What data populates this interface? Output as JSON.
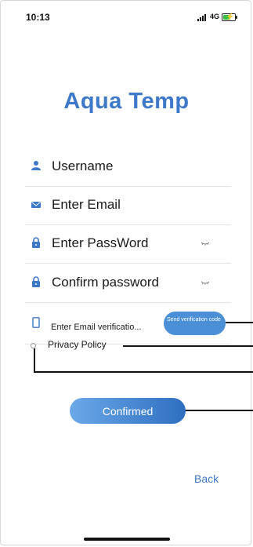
{
  "status_bar": {
    "time": "10:13",
    "network": "4G"
  },
  "app": {
    "title": "Aqua Temp"
  },
  "form": {
    "username_placeholder": "Username",
    "email_placeholder": "Enter Email",
    "password_placeholder": "Enter PassWord",
    "confirm_password_placeholder": "Confirm password",
    "verification_placeholder": "Enter Email verificatio...",
    "send_code_label": "Send verification code"
  },
  "privacy": {
    "label": "Privacy Policy"
  },
  "actions": {
    "confirm_label": "Confirmed",
    "back_label": "Back"
  },
  "colors": {
    "accent": "#3d78c9",
    "button": "#4b8fd6"
  }
}
